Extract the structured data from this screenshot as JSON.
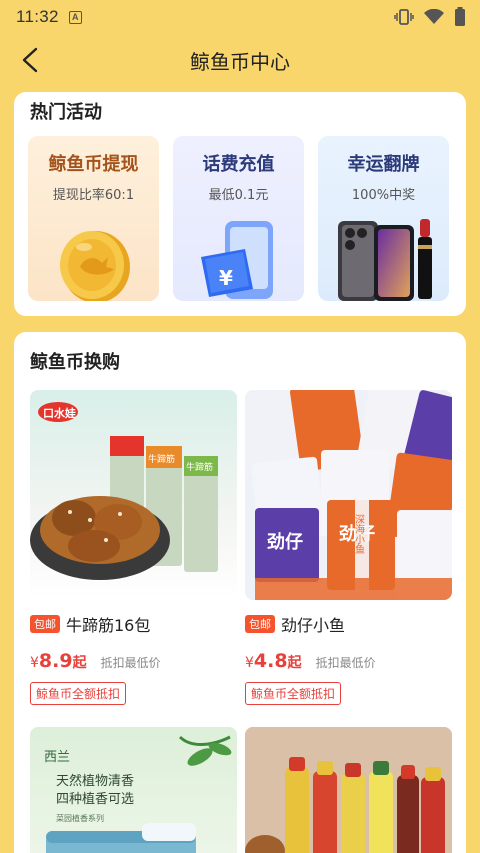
{
  "status_bar": {
    "time": "11:32",
    "notification_letter": "A"
  },
  "header": {
    "title": "鲸鱼币中心"
  },
  "activities": {
    "title": "热门活动",
    "items": [
      {
        "title": "鲸鱼币提现",
        "subtitle": "提现比率60:1",
        "icon": "gold-coin-icon"
      },
      {
        "title": "话费充值",
        "subtitle": "最低0.1元",
        "icon": "phone-yuan-icon"
      },
      {
        "title": "幸运翻牌",
        "subtitle": "100%中奖",
        "icon": "phone-lipstick-icon"
      }
    ]
  },
  "exchange": {
    "title": "鲸鱼币换购",
    "products": [
      {
        "badge": "包邮",
        "name": "牛蹄筋16包",
        "currency": "¥",
        "price": "8.9",
        "suffix": "起",
        "note": "抵扣最低价",
        "tag": "鲸鱼币全额抵扣",
        "brand": "口水娃",
        "img_text1": "牛蹄筋",
        "img_text2": "牛蹄筋"
      },
      {
        "badge": "包邮",
        "name": "劲仔小鱼",
        "currency": "¥",
        "price": "4.8",
        "suffix": "起",
        "note": "抵扣最低价",
        "tag": "鲸鱼币全额抵扣",
        "brand": "劲仔",
        "img_text1": "深海小鱼",
        "img_text2": "劲仔"
      },
      {
        "brand": "西兰",
        "img_text1": "天然植物清香",
        "img_text2": "四种植香可选",
        "img_text3": "菜园植香系列"
      },
      {
        "brand": ""
      }
    ]
  },
  "colors": {
    "background": "#F9D66B",
    "accent_red": "#E8403A",
    "badge_orange": "#F4532E"
  }
}
